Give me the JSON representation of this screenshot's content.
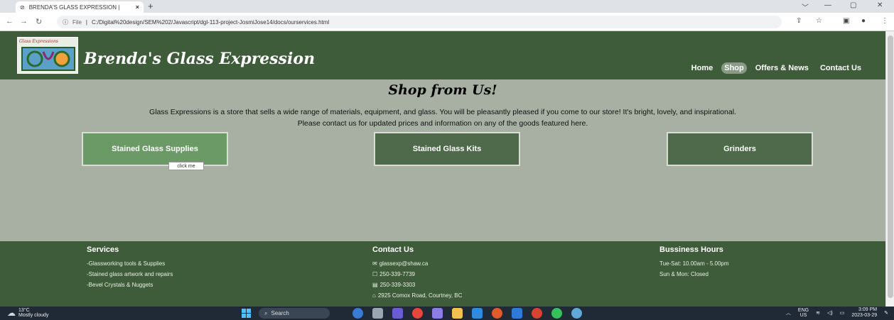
{
  "browser": {
    "tab_title": "BRENDA'S GLASS EXPRESSION |",
    "new_tab": "+",
    "url_label": "File",
    "url": "C:/Digital%20design/SEM%202/Javascript/dgl-113-project-JosmiJose14/docs/ourservices.html"
  },
  "header": {
    "logo_text": "Glass Expressions",
    "brand": "Brenda's Glass Expression",
    "nav": [
      "Home",
      "Shop",
      "Offers & News",
      "Contact Us"
    ]
  },
  "main": {
    "title": "Shop from Us!",
    "intro_line1": "Glass Expressions is a store that sells a wide range of materials, equipment, and glass. You will be pleasantly pleased if you come to our store! It's bright, lovely, and inspirational.",
    "intro_line2": "Please contact us for updated prices and information on any of the goods featured here.",
    "cards": [
      "Stained Glass Supplies",
      "Stained Glass Kits",
      "Grinders"
    ],
    "tooltip": "click me"
  },
  "footer": {
    "services": {
      "heading": "Services",
      "items": [
        "-Glassworking tools & Supplies",
        "-Stained glass artwork and repairs",
        "-Bevel Crystals & Nuggets"
      ]
    },
    "contact": {
      "heading": "Contact Us",
      "email": "glassexp@shaw.ca",
      "phone": "250-339-7739",
      "fax": "250-339-3303",
      "address": "2925 Comox Road, Courtney, BC"
    },
    "hours": {
      "heading": "Bussiness Hours",
      "items": [
        "Tue-Sat: 10.00am - 5.00pm",
        "Sun & Mon: Closed"
      ]
    }
  },
  "taskbar": {
    "temp": "13°C",
    "weather": "Mostly cloudy",
    "search": "Search",
    "lang1": "ENG",
    "lang2": "US",
    "time": "3:09 PM",
    "date": "2023-03-29"
  },
  "colors": {
    "header_green": "#3f5c3a",
    "page_bg": "#a7b0a3",
    "card_green": "#4e6a4b",
    "card_hover": "#6c9a66"
  }
}
